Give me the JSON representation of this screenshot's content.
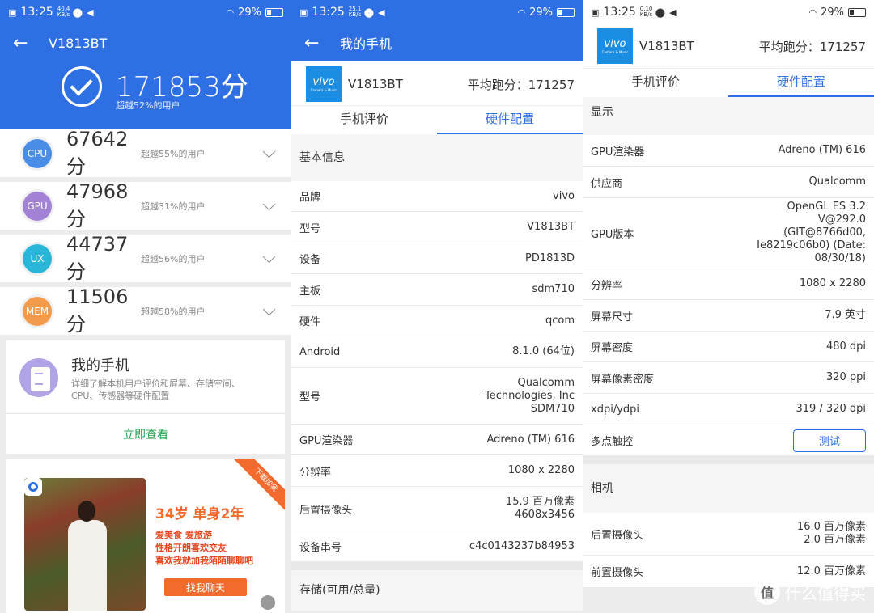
{
  "status": {
    "time": "13:25",
    "battery": "29%",
    "speeds": [
      "40.4 KB/s",
      "25.1 KB/s",
      "0.10 KB/s"
    ]
  },
  "panel1": {
    "title": "V1813BT",
    "total_score": "171853分",
    "total_rank": "超越52%的用户",
    "benchmarks": [
      {
        "badge": "CPU",
        "score": "67642分",
        "rank": "超越55%的用户",
        "color": "#4a8de6"
      },
      {
        "badge": "GPU",
        "score": "47968分",
        "rank": "超越31%的用户",
        "color": "#a282d4"
      },
      {
        "badge": "UX",
        "score": "44737分",
        "rank": "超越56%的用户",
        "color": "#29b6d8"
      },
      {
        "badge": "MEM",
        "score": "11506分",
        "rank": "超越58%的用户",
        "color": "#f29b4d"
      }
    ],
    "myphone": {
      "title": "我的手机",
      "desc": "详细了解本机用户评价和屏幕、存储空间、CPU、传感器等硬件配置",
      "link": "立即查看"
    },
    "ad": {
      "ribbon": "下载加我",
      "headline": "34岁 单身2年",
      "lines": [
        "爱美食 爱旅游",
        "性格开朗喜欢交友",
        "喜欢我就加我陌陌聊聊吧"
      ],
      "button": "找我聊天"
    }
  },
  "panel2": {
    "title": "我的手机",
    "logo": "vivo",
    "logo_sub": "Camera & Music",
    "model": "V1813BT",
    "avg_score": "平均跑分：171257",
    "tabs": [
      "手机评价",
      "硬件配置"
    ],
    "section1": "基本信息",
    "rows": [
      {
        "key": "品牌",
        "val": "vivo"
      },
      {
        "key": "型号",
        "val": "V1813BT"
      },
      {
        "key": "设备",
        "val": "PD1813D"
      },
      {
        "key": "主板",
        "val": "sdm710"
      },
      {
        "key": "硬件",
        "val": "qcom"
      },
      {
        "key": "Android",
        "val": "8.1.0 (64位)"
      },
      {
        "key": "型号",
        "val": "Qualcomm Technologies, Inc SDM710"
      },
      {
        "key": "GPU渲染器",
        "val": "Adreno (TM) 616"
      },
      {
        "key": "分辨率",
        "val": "1080 x 2280"
      },
      {
        "key": "后置摄像头",
        "val": "15.9 百万像素 4608x3456"
      },
      {
        "key": "设备串号",
        "val": "c4c0143237b84953"
      }
    ],
    "section2": "存储(可用/总量)"
  },
  "panel3": {
    "logo": "vivo",
    "logo_sub": "Camera & Music",
    "model": "V1813BT",
    "avg_score": "平均跑分：171257",
    "tabs": [
      "手机评价",
      "硬件配置"
    ],
    "section1": "显示",
    "rows": [
      {
        "key": "GPU渲染器",
        "val": "Adreno (TM) 616"
      },
      {
        "key": "供应商",
        "val": "Qualcomm"
      },
      {
        "key": "GPU版本",
        "val": "OpenGL ES 3.2 V@292.0 (GIT@8766d00, Ie8219c06b0) (Date: 08/30/18)"
      },
      {
        "key": "分辨率",
        "val": "1080 x 2280"
      },
      {
        "key": "屏幕尺寸",
        "val": "7.9 英寸"
      },
      {
        "key": "屏幕密度",
        "val": "480 dpi"
      },
      {
        "key": "屏幕像素密度",
        "val": "320 ppi"
      },
      {
        "key": "xdpi/ydpi",
        "val": "319 / 320 dpi"
      }
    ],
    "touch_key": "多点触控",
    "touch_button": "测试",
    "section2": "相机",
    "camera_rows": [
      {
        "key": "后置摄像头",
        "val": "16.0 百万像素 2.0 百万像素"
      },
      {
        "key": "前置摄像头",
        "val": "12.0 百万像素"
      }
    ],
    "watermark": "什么值得买",
    "watermark_badge": "值"
  }
}
